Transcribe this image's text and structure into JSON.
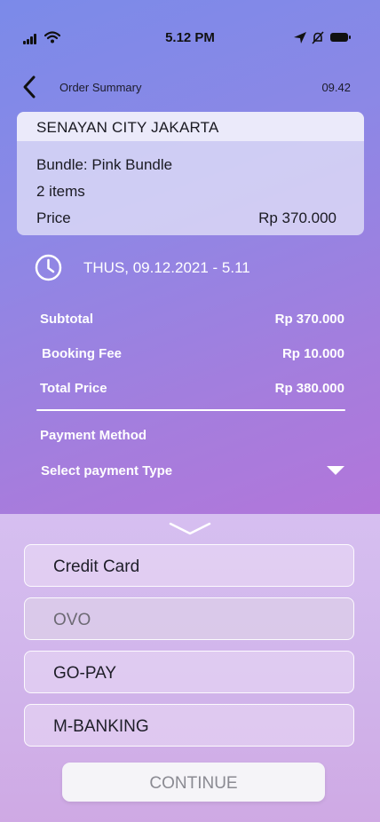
{
  "status_bar": {
    "time": "5.12 PM"
  },
  "header": {
    "title": "Order Summary",
    "time": "09.42"
  },
  "order": {
    "venue": "SENAYAN CITY JAKARTA",
    "bundle": "Bundle: Pink Bundle",
    "items": "2 items",
    "price_label": "Price",
    "price_value": "Rp 370.000"
  },
  "schedule": {
    "datetime": "THUS, 09.12.2021 - 5.11"
  },
  "summary": {
    "subtotal_label": "Subtotal",
    "subtotal_value": "Rp 370.000",
    "booking_label": "Booking Fee",
    "booking_value": "Rp 10.000",
    "total_label": "Total Price",
    "total_value": "Rp 380.000"
  },
  "payment": {
    "label": "Payment Method",
    "select_placeholder": "Select payment Type",
    "options": [
      "Credit Card",
      "OVO",
      "GO-PAY",
      "M-BANKING"
    ]
  },
  "continue_label": "CONTINUE",
  "icons": {
    "back": "chevron-left-icon",
    "clock": "clock-icon",
    "dropdown": "caret-down-icon",
    "collapse": "chevron-down-icon"
  },
  "colors": {
    "accent_top": "#7b8ae9",
    "accent_bottom": "#b276da",
    "sheet": "#d6bff0"
  }
}
